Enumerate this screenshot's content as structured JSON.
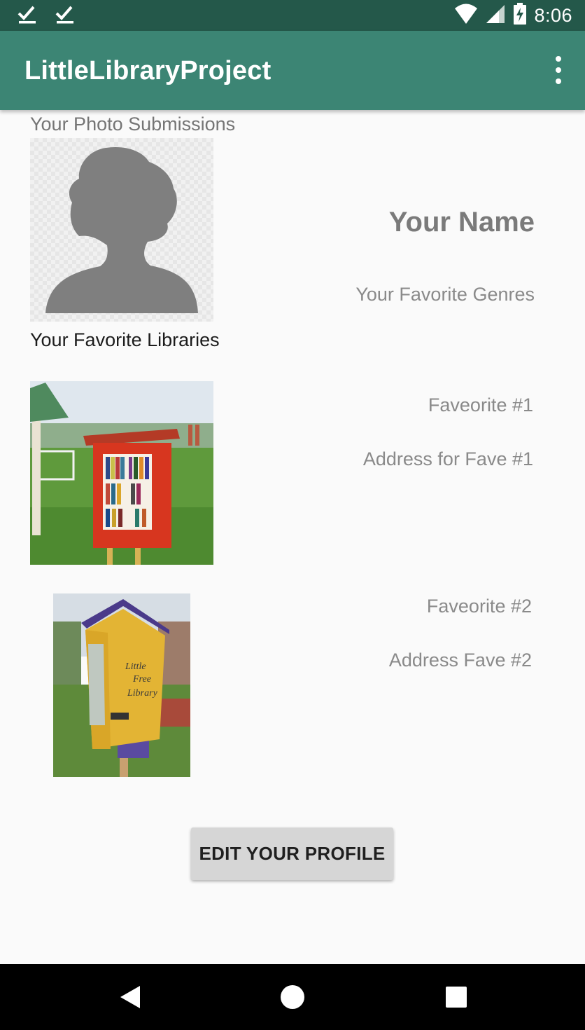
{
  "status_bar": {
    "time": "8:06"
  },
  "app_bar": {
    "title": "LittleLibraryProject"
  },
  "profile": {
    "photo_submissions_label": "Your Photo Submissions",
    "name": "Your Name",
    "favorite_genres": "Your Favorite Genres",
    "favorite_libraries_label": "Your Favorite Libraries"
  },
  "favorites": [
    {
      "title": "Faveorite #1",
      "address": "Address for Fave #1"
    },
    {
      "title": "Faveorite #2",
      "address": "Address Fave #2"
    }
  ],
  "library_sign_text": "Little Free Library",
  "edit_button_label": "EDIT YOUR PROFILE",
  "colors": {
    "status_bar": "#24584a",
    "app_bar": "#3c8574",
    "background": "#fafafa",
    "button": "#d6d6d6"
  }
}
